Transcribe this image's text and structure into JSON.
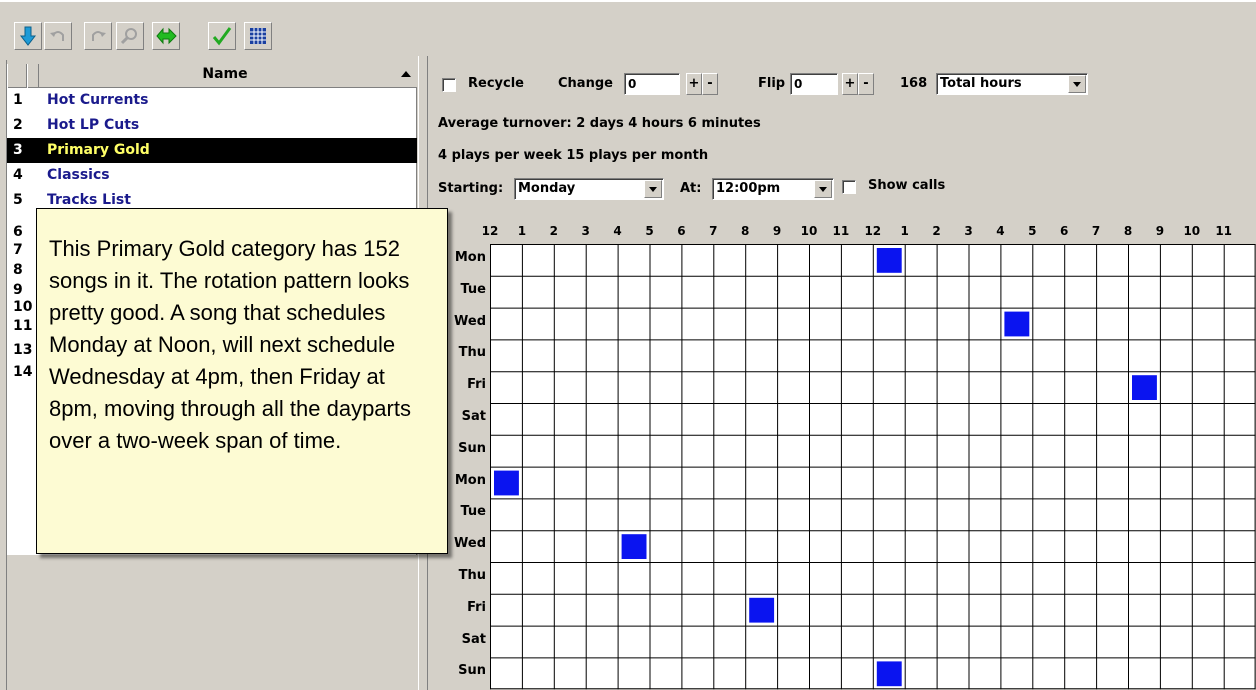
{
  "toolbar": {
    "buttons": [
      {
        "icon": "down-arrow-icon",
        "color": "#1e9bd7"
      },
      {
        "icon": "undo-icon",
        "color": "#a0a0a0"
      },
      {
        "icon": "redo-icon",
        "color": "#a0a0a0"
      },
      {
        "icon": "search-icon",
        "color": "#a0a0a0"
      },
      {
        "icon": "play-arrow-icon",
        "color": "#22bb22"
      },
      {
        "icon": "checkmark-icon",
        "color": "#22aa22"
      },
      {
        "icon": "grid-icon",
        "color": "#1a3fa0"
      }
    ]
  },
  "list": {
    "header": "Name",
    "rows": [
      {
        "num": "1",
        "name": "Hot Currents"
      },
      {
        "num": "2",
        "name": "Hot LP Cuts"
      },
      {
        "num": "3",
        "name": "Primary Gold",
        "selected": true
      },
      {
        "num": "4",
        "name": "Classics"
      },
      {
        "num": "5",
        "name": "Tracks List"
      },
      {
        "num": "6",
        "name": ""
      },
      {
        "num": "7",
        "name": ""
      },
      {
        "num": "8",
        "name": ""
      },
      {
        "num": "9",
        "name": ""
      },
      {
        "num": "10",
        "name": ""
      },
      {
        "num": "11",
        "name": ""
      },
      {
        "num": "13",
        "name": ""
      },
      {
        "num": "14",
        "name": ""
      }
    ]
  },
  "tooltip": {
    "text": "This Primary Gold category has 152 songs in it. The rotation pattern looks pretty good.  A song that schedules Monday at Noon, will next schedule Wednesday at 4pm, then Friday at 8pm, moving through all the dayparts over a two-week span of time."
  },
  "controls": {
    "recycle_label": "Recycle",
    "change_label": "Change",
    "change_value": "0",
    "plus": "+",
    "minus": "-",
    "flip_label": "Flip",
    "flip_value": "0",
    "hours_value": "168",
    "hours_select": "Total hours",
    "turnover": "Average turnover: 2 days 4 hours 6 minutes",
    "plays": "4 plays per week 15 plays per month",
    "starting_label": "Starting:",
    "starting_value": "Monday",
    "at_label": "At:",
    "at_value": "12:00pm",
    "show_calls_label": "Show calls"
  },
  "grid": {
    "hours": [
      "12",
      "1",
      "2",
      "3",
      "4",
      "5",
      "6",
      "7",
      "8",
      "9",
      "10",
      "11",
      "12",
      "1",
      "2",
      "3",
      "4",
      "5",
      "6",
      "7",
      "8",
      "9",
      "10",
      "11"
    ],
    "days": [
      "Mon",
      "Tue",
      "Wed",
      "Thu",
      "Fri",
      "Sat",
      "Sun",
      "Mon",
      "Tue",
      "Wed",
      "Thu",
      "Fri",
      "Sat",
      "Sun"
    ],
    "fill_color": "#0a14f0",
    "filled_cells": [
      {
        "day_row": 0,
        "hour_col": 12
      },
      {
        "day_row": 2,
        "hour_col": 16
      },
      {
        "day_row": 4,
        "hour_col": 20
      },
      {
        "day_row": 7,
        "hour_col": 0
      },
      {
        "day_row": 9,
        "hour_col": 4
      },
      {
        "day_row": 11,
        "hour_col": 8
      },
      {
        "day_row": 13,
        "hour_col": 12
      }
    ]
  }
}
